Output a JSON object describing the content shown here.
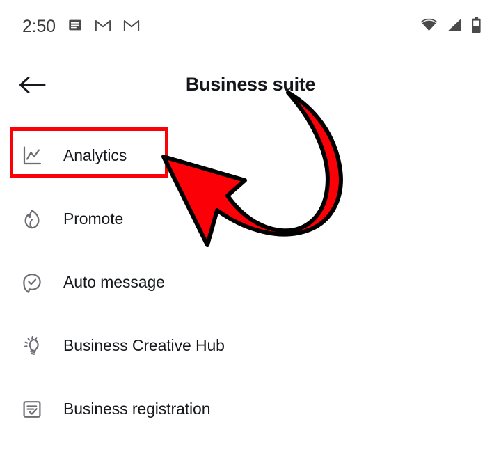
{
  "status_bar": {
    "time": "2:50",
    "left_icons": [
      {
        "name": "news-article-icon"
      },
      {
        "name": "gmail-m-icon"
      },
      {
        "name": "gmail-m-icon"
      }
    ],
    "right_icons": [
      {
        "name": "wifi-icon"
      },
      {
        "name": "cellular-signal-icon"
      },
      {
        "name": "battery-icon"
      }
    ]
  },
  "app_bar": {
    "back_label": "back-arrow",
    "title": "Business suite"
  },
  "menu": {
    "items": [
      {
        "label": "Analytics",
        "icon": "line-chart-icon"
      },
      {
        "label": "Promote",
        "icon": "flame-icon"
      },
      {
        "label": "Auto message",
        "icon": "chat-bubble-check-icon"
      },
      {
        "label": "Business Creative Hub",
        "icon": "lightbulb-idea-icon"
      },
      {
        "label": "Business registration",
        "icon": "document-check-icon"
      }
    ]
  },
  "annotations": {
    "highlight": {
      "target": "Analytics",
      "color": "#fb0007"
    },
    "arrow": {
      "target": "Analytics",
      "fill_color": "#fb0007",
      "stroke_color": "#000000",
      "direction": "curved-left"
    }
  }
}
